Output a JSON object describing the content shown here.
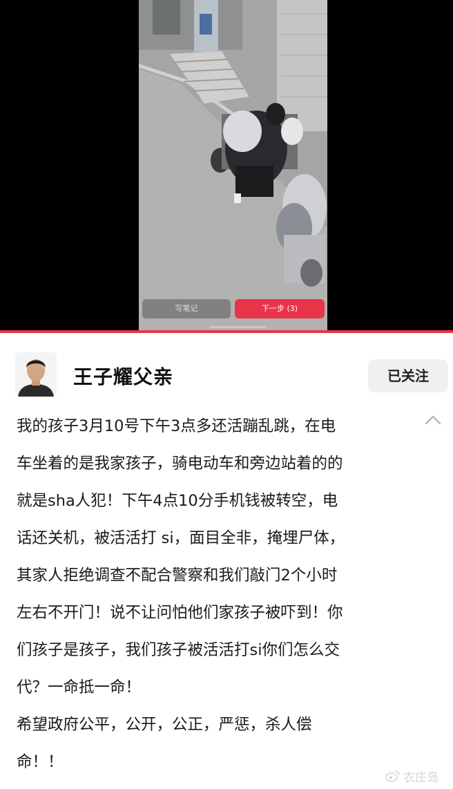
{
  "video": {
    "note_button": "写笔记",
    "next_button": "下一步 (3)"
  },
  "post": {
    "author": "王子耀父亲",
    "follow_button": "已关注",
    "lines": [
      "我的孩子3月10号下午3点多还活蹦乱跳，在电",
      "车坐着的是我家孩子，骑电动车和旁边站着的的",
      "就是sha人犯！下午4点10分手机钱被转空，电",
      "话还关机，被活活打 si，面目全非，掩埋尸体，",
      "其家人拒绝调查不配合警察和我们敲门2个小时",
      "左右不开门！说不让问怕他们家孩子被吓到！你",
      "们孩子是孩子，我们孩子被活活打si你们怎么交",
      "代？一命抵一命！",
      "希望政府公平，公开，公正，严惩，杀人偿",
      "命！！"
    ]
  },
  "watermark": {
    "text": "农庄岛",
    "icon": "weibo-icon"
  },
  "colors": {
    "accent": "#e9344a",
    "follow_bg": "#f0f0f0",
    "text": "#1a1a1a"
  }
}
